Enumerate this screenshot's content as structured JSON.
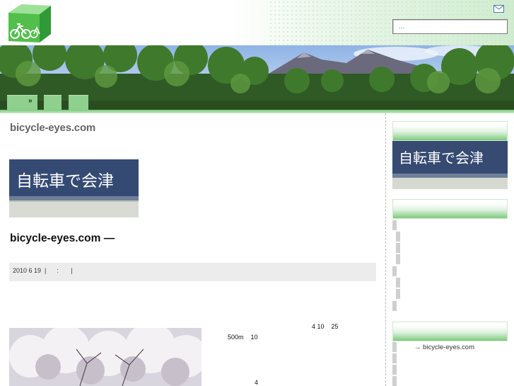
{
  "header": {
    "logo_name": "bicycle-cube-logo",
    "mail_icon": "mail-icon",
    "search_placeholder": "..."
  },
  "nav": {
    "chevron": "»"
  },
  "main": {
    "site_title": "bicycle-eyes.com",
    "thumb_caption": "自転車で会津",
    "post_title": "bicycle-eyes.com —",
    "meta": "2010 6 19  |      :       |",
    "text_lines": [
      "4 10    25",
      "500m    10",
      "4"
    ]
  },
  "sidebar": {
    "banner_caption": "自転車で会津",
    "link_label": "→ bicycle-eyes.com"
  },
  "colors": {
    "accent_green": "#8fd08f",
    "meta_bg": "#ececec",
    "sidebar_banner_bg": "#364a72"
  }
}
